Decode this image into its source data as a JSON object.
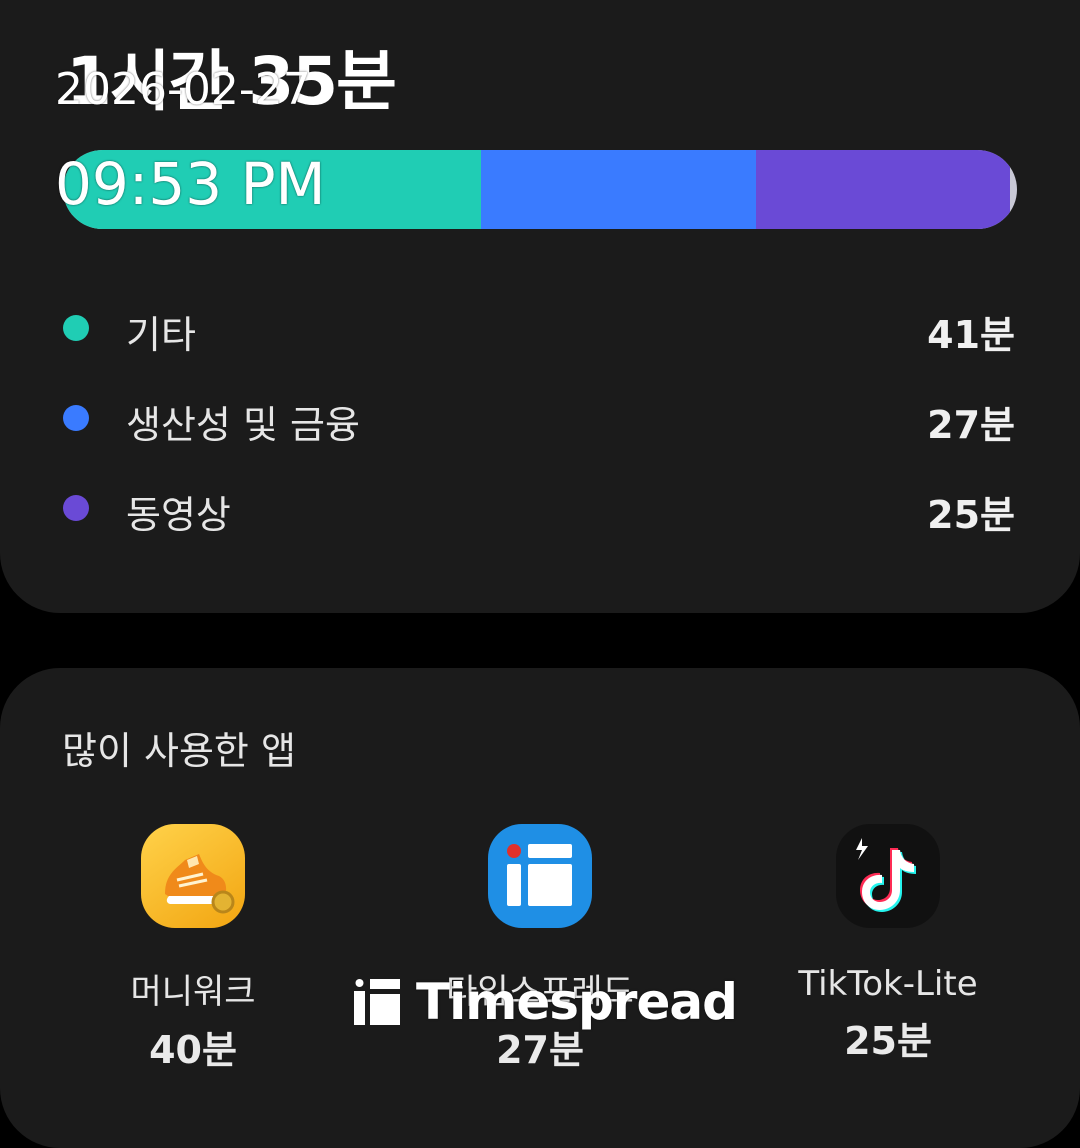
{
  "summary": {
    "total_time": "1시간 35분",
    "bar_segments": [
      {
        "category": "기타",
        "minutes": 41,
        "color": "#20cdb4"
      },
      {
        "category": "생산성 및 금융",
        "minutes": 27,
        "color": "#3a7bff"
      },
      {
        "category": "동영상",
        "minutes": 25,
        "color": "#6a4ad6"
      }
    ],
    "legend": [
      {
        "label": "기타",
        "value": "41분",
        "color": "#20cdb4"
      },
      {
        "label": "생산성 및 금융",
        "value": "27분",
        "color": "#3a7bff"
      },
      {
        "label": "동영상",
        "value": "25분",
        "color": "#6a4ad6"
      }
    ]
  },
  "most_used": {
    "title": "많이 사용한 앱",
    "apps": [
      {
        "name": "머니워크",
        "time": "40분",
        "icon": "sneaker-icon"
      },
      {
        "name": "타임스프레드",
        "time": "27분",
        "icon": "timespread-icon"
      },
      {
        "name": "TikTok-Lite",
        "time": "25분",
        "icon": "tiktok-icon"
      }
    ]
  },
  "overlay": {
    "date": "2026-02-27",
    "time": "09:53 PM"
  },
  "watermark": {
    "brand": "Timespread"
  }
}
